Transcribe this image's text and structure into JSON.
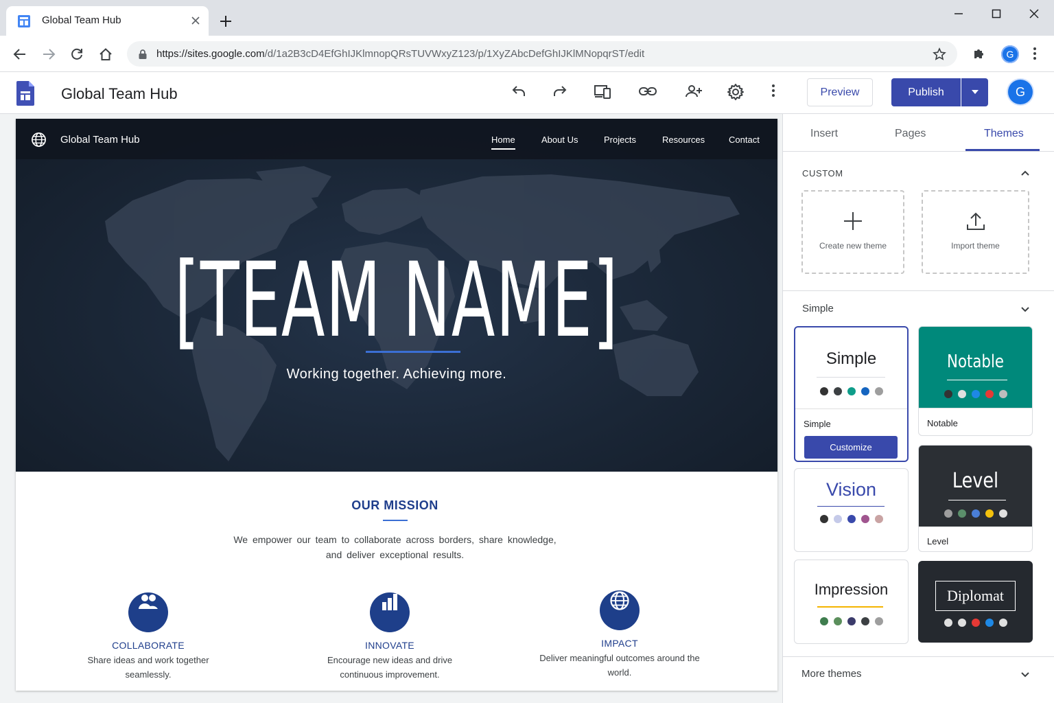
{
  "browser": {
    "tab_title": "Global Team Hub",
    "url_host": "https://sites.google.com",
    "url_path": "/d/1a2B3cD4EfGhIJKlmnopQRsTUVWxyZ123/p/1XyZAbcDefGhIJKlMNopqrST/edit",
    "profile_initial": "G"
  },
  "app": {
    "title": "Global Team Hub",
    "preview_label": "Preview",
    "publish_label": "Publish",
    "avatar_initial": "G",
    "accent": "#3949ab"
  },
  "site": {
    "name": "Global Team Hub",
    "nav": [
      "Home",
      "About Us",
      "Projects",
      "Resources",
      "Contact"
    ],
    "hero_title": "[TEAM NAME]",
    "hero_subtitle": "Working together. Achieving more.",
    "mission_title": "OUR MISSION",
    "mission_text": "We empower our team to collaborate across borders, share knowledge, and deliver exceptional results.",
    "features": [
      {
        "icon": "people-icon",
        "title": "COLLABORATE",
        "desc": "Share ideas and work together seamlessly."
      },
      {
        "icon": "bar-chart-icon",
        "title": "INNOVATE",
        "desc": "Encourage new ideas and drive continuous improvement."
      },
      {
        "icon": "globe-icon",
        "title": "IMPACT",
        "desc": "Deliver meaningful outcomes around the world."
      }
    ]
  },
  "panel": {
    "tabs": [
      "Insert",
      "Pages",
      "Themes"
    ],
    "active_tab": "Themes",
    "custom_label": "CUSTOM",
    "create_theme": "Create new theme",
    "import_theme": "Import theme",
    "simple_section": "Simple",
    "customize_label": "Customize",
    "more_themes": "More themes",
    "themes": [
      {
        "name": "Simple",
        "label": "Simple",
        "dots": [
          "#333333",
          "#3c4043",
          "#0f9d8a",
          "#1565c0",
          "#9e9e9e"
        ]
      },
      {
        "name": "Notable",
        "label": "Notable",
        "dots": [
          "#333333",
          "#e0e0e0",
          "#1e88e5",
          "#e53935",
          "#bdbdbd"
        ]
      },
      {
        "name": "Vision",
        "label": "",
        "dots": [
          "#333333",
          "#c5cae9",
          "#3949ab",
          "#a0558f",
          "#c9a3a3"
        ]
      },
      {
        "name": "Level",
        "label": "Level",
        "dots": [
          "#9e9e9e",
          "#5b8f6b",
          "#4a7fd8",
          "#f4c20d",
          "#e0e0e0"
        ]
      },
      {
        "name": "Impression",
        "label": "",
        "dots": [
          "#3f7d4e",
          "#5b8f5c",
          "#3b3b6b",
          "#3c4043",
          "#9e9e9e"
        ]
      },
      {
        "name": "Diplomat",
        "label": "",
        "dots": [
          "#e0e0e0",
          "#e0e0e0",
          "#e53935",
          "#1e88e5",
          "#e0e0e0"
        ]
      }
    ]
  }
}
